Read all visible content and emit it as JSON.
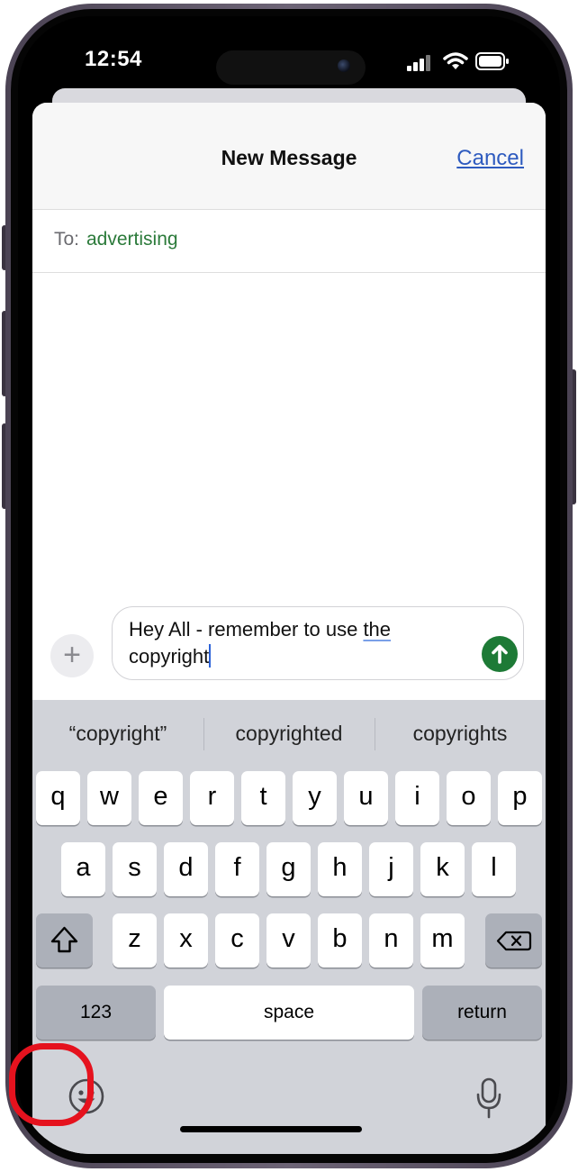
{
  "status_bar": {
    "time": "12:54"
  },
  "header": {
    "title": "New Message",
    "cancel_label": "Cancel"
  },
  "recipient": {
    "label": "To:",
    "value": "advertising"
  },
  "composer": {
    "line1": "Hey All - remember to use ",
    "line1_underlined": "the",
    "line2": "copyright"
  },
  "suggestions": [
    "“copyright”",
    "copyrighted",
    "copyrights"
  ],
  "keyboard": {
    "row1": [
      "q",
      "w",
      "e",
      "r",
      "t",
      "y",
      "u",
      "i",
      "o",
      "p"
    ],
    "row2": [
      "a",
      "s",
      "d",
      "f",
      "g",
      "h",
      "j",
      "k",
      "l"
    ],
    "row3": [
      "z",
      "x",
      "c",
      "v",
      "b",
      "n",
      "m"
    ],
    "numbers_label": "123",
    "space_label": "space",
    "return_label": "return"
  },
  "icons": [
    "wifi-icon",
    "signal-icon",
    "battery-icon",
    "plus-icon",
    "send-arrow-icon",
    "shift-icon",
    "backspace-icon",
    "emoji-icon",
    "microphone-icon"
  ],
  "colors": {
    "accent_link": "#2e5bbf",
    "recipient": "#2b7a3a",
    "send_button": "#1d7a36",
    "highlight_ring": "#e5121e"
  }
}
